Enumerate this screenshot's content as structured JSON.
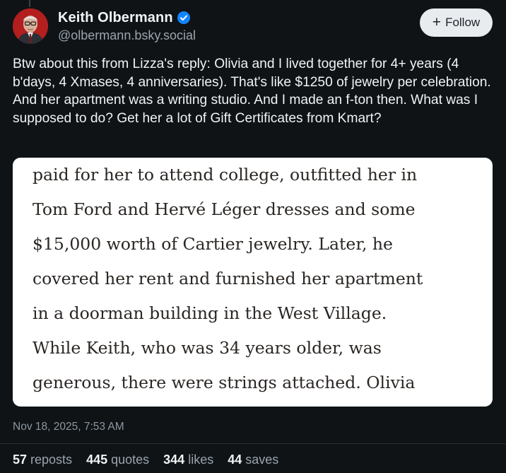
{
  "author": {
    "display_name": "Keith Olbermann",
    "handle": "@olbermann.bsky.social",
    "verified_icon": "verified-check-icon",
    "avatar_bg": "#b31e1e"
  },
  "follow_button": {
    "icon": "plus-icon",
    "label": "Follow"
  },
  "post": {
    "text": "Btw about this from Lizza's reply: Olivia and I lived together for 4+ years (4 b'days, 4 Xmases, 4 anniversaries). That's like $1250 of jewelry per celebration. And her apartment was a writing studio. And I made an f-ton then. What was I supposed to do? Get her a lot of Gift Certificates from Kmart?",
    "embed_lines": [
      "paid for her to attend college, outfitted her in",
      "Tom Ford and Hervé Léger dresses and some",
      "$15,000 worth of Cartier jewelry. Later, he",
      "covered her rent and furnished her apartment",
      "in a doorman building in the West Village.",
      "While Keith, who was 34 years older, was",
      "generous, there were strings attached. Olivia"
    ],
    "timestamp": "Nov 18, 2025, 7:53 AM"
  },
  "stats": [
    {
      "count": "57",
      "label": "reposts"
    },
    {
      "count": "445",
      "label": "quotes"
    },
    {
      "count": "344",
      "label": "likes"
    },
    {
      "count": "44",
      "label": "saves"
    }
  ],
  "colors": {
    "background": "#0f1316",
    "verified_blue": "#1185fe",
    "follow_bg": "#e9ecef"
  }
}
